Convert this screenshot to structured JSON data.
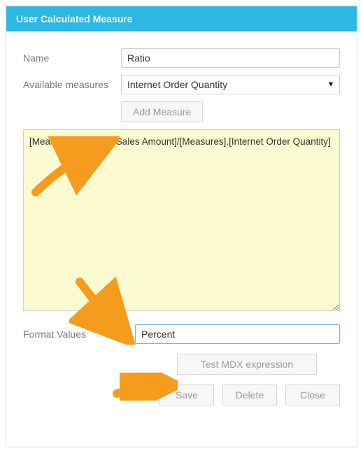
{
  "dialog": {
    "title": "User Calculated Measure"
  },
  "form": {
    "name_label": "Name",
    "name_value": "Ratio",
    "measures_label": "Available measures",
    "measures_selected": "Internet Order Quantity",
    "add_measure_label": "Add Measure",
    "expression_value": "[Measures].[Internet Sales Amount]/[Measures].[Internet Order Quantity]",
    "format_label": "Format Values",
    "format_value": "Percent",
    "test_button_label": "Test MDX expression"
  },
  "actions": {
    "save": "Save",
    "delete": "Delete",
    "close": "Close"
  },
  "colors": {
    "header_bg": "#2cb8e3",
    "arrow": "#f59b1e"
  }
}
